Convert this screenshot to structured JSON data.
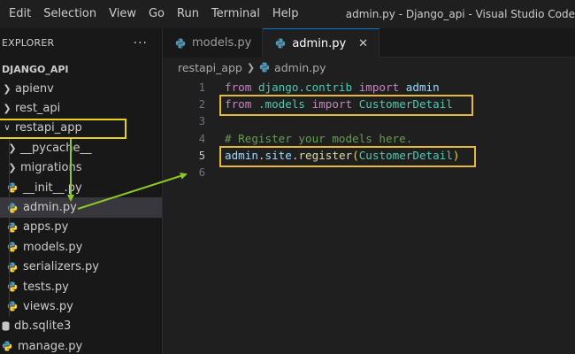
{
  "menubar": {
    "items": [
      "Edit",
      "Selection",
      "View",
      "Go",
      "Run",
      "Terminal",
      "Help"
    ],
    "window_title": "admin.py - Django_api - Visual Studio Code"
  },
  "sidebar": {
    "title": "EXPLORER",
    "more": "···",
    "project": "DJANGO_API",
    "tree": [
      {
        "label": "apienv",
        "type": "folder",
        "expanded": false
      },
      {
        "label": "rest_api",
        "type": "folder",
        "expanded": false
      },
      {
        "label": "restapi_app",
        "type": "folder",
        "expanded": true
      },
      {
        "label": "__pycache__",
        "type": "folder",
        "expanded": false
      },
      {
        "label": "migrations",
        "type": "folder",
        "expanded": false
      },
      {
        "label": "__init__.py",
        "type": "python"
      },
      {
        "label": "admin.py",
        "type": "python",
        "selected": true
      },
      {
        "label": "apps.py",
        "type": "python"
      },
      {
        "label": "models.py",
        "type": "python"
      },
      {
        "label": "serializers.py",
        "type": "python"
      },
      {
        "label": "tests.py",
        "type": "python"
      },
      {
        "label": "views.py",
        "type": "python"
      },
      {
        "label": "db.sqlite3",
        "type": "database"
      },
      {
        "label": "manage.py",
        "type": "python"
      }
    ]
  },
  "editor": {
    "tabs": [
      {
        "label": "models.py",
        "active": false
      },
      {
        "label": "admin.py",
        "active": true,
        "close": "✕"
      }
    ],
    "breadcrumb": {
      "folder": "restapi_app",
      "file": "admin.py"
    },
    "current_line": 5,
    "lines": [
      {
        "n": "1",
        "tokens": [
          [
            "kw",
            "from"
          ],
          [
            "punc",
            " "
          ],
          [
            "mod",
            "django.contrib"
          ],
          [
            "punc",
            " "
          ],
          [
            "kw",
            "import"
          ],
          [
            "punc",
            " "
          ],
          [
            "var",
            "admin"
          ]
        ]
      },
      {
        "n": "2",
        "tokens": [
          [
            "kw",
            "from"
          ],
          [
            "punc",
            " "
          ],
          [
            "mod",
            ".models"
          ],
          [
            "punc",
            " "
          ],
          [
            "kw",
            "import"
          ],
          [
            "punc",
            " "
          ],
          [
            "cls",
            "CustomerDetail"
          ]
        ]
      },
      {
        "n": "3",
        "tokens": []
      },
      {
        "n": "4",
        "tokens": [
          [
            "cmt",
            "# Register your models here."
          ]
        ]
      },
      {
        "n": "5",
        "tokens": [
          [
            "var",
            "admin"
          ],
          [
            "punc",
            "."
          ],
          [
            "var",
            "site"
          ],
          [
            "punc",
            "."
          ],
          [
            "fn",
            "register"
          ],
          [
            "paren",
            "("
          ],
          [
            "cls",
            "CustomerDetail"
          ],
          [
            "paren",
            ")"
          ]
        ]
      },
      {
        "n": "6",
        "tokens": []
      }
    ]
  },
  "colors": {
    "annotation_box": "#e6d020",
    "annotation_arrow": "#8ac926",
    "code_highlight": "#e2b93b"
  }
}
